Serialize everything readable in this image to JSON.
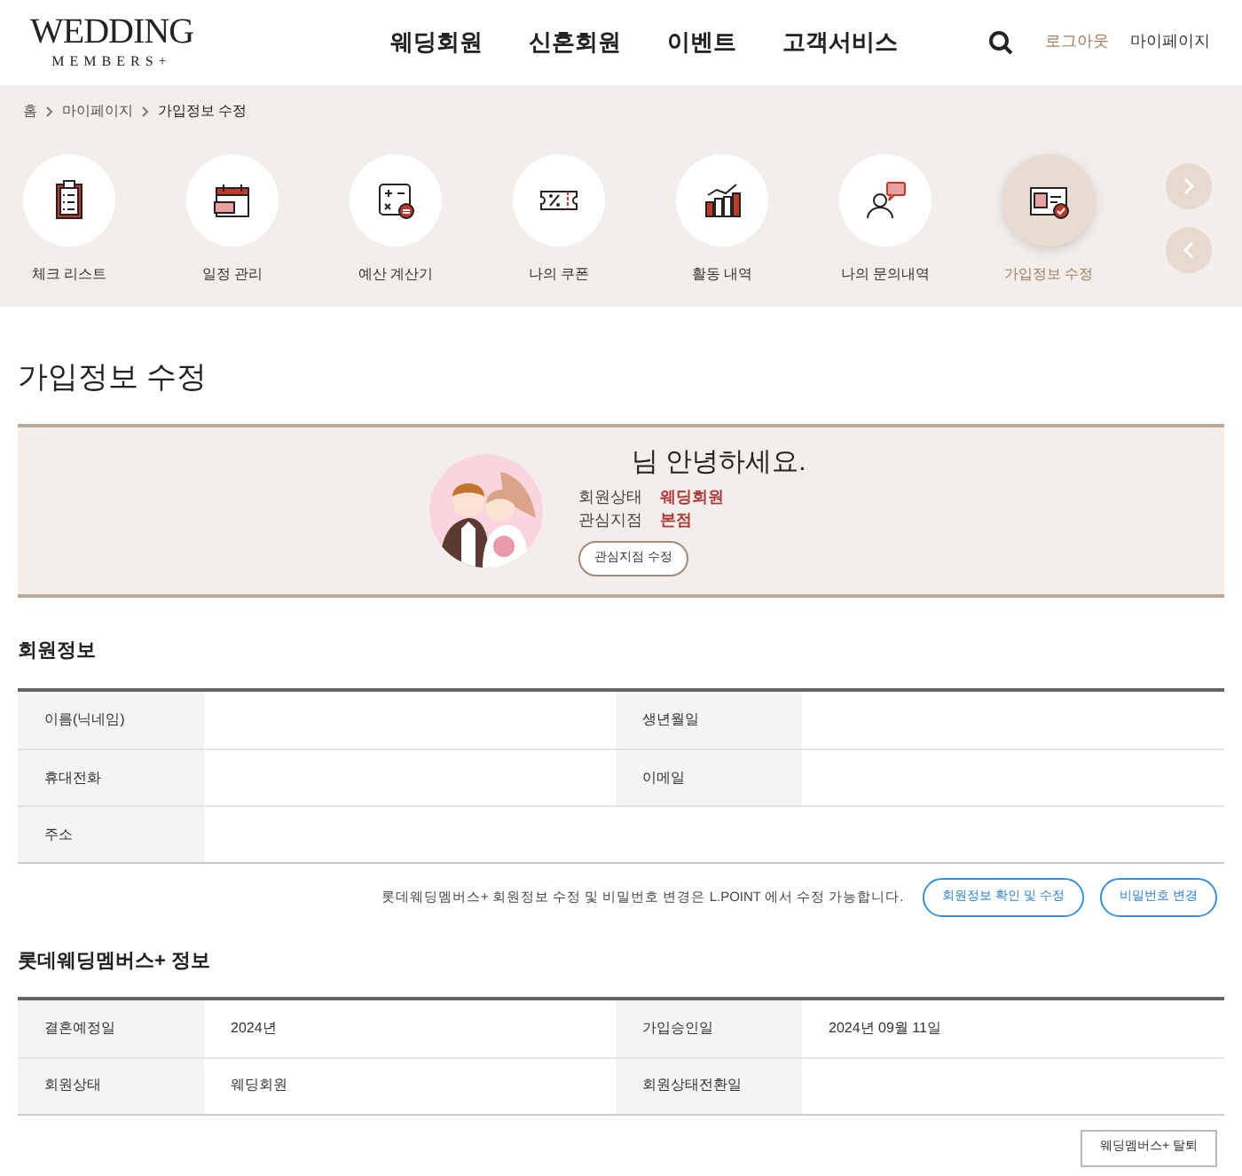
{
  "header": {
    "logo_line1": "WEDDING",
    "logo_line2": "MEMBERS+",
    "nav": [
      "웨딩회원",
      "신혼회원",
      "이벤트",
      "고객서비스"
    ],
    "logout": "로그아웃",
    "mypage": "마이페이지"
  },
  "breadcrumb": [
    "홈",
    "마이페이지",
    "가입정보 수정"
  ],
  "menu": [
    {
      "label": "체크 리스트",
      "selected": false
    },
    {
      "label": "일정 관리",
      "selected": false
    },
    {
      "label": "예산 계산기",
      "selected": false
    },
    {
      "label": "나의 쿠폰",
      "selected": false
    },
    {
      "label": "활동 내역",
      "selected": false
    },
    {
      "label": "나의 문의내역",
      "selected": false
    },
    {
      "label": "가입정보 수정",
      "selected": true
    }
  ],
  "page_title": "가입정보 수정",
  "profile": {
    "greeting": "님 안녕하세요.",
    "fields": [
      {
        "label": "회원상태",
        "value": "웨딩회원"
      },
      {
        "label": "관심지점",
        "value": "본점"
      }
    ],
    "button": "관심지점 수정"
  },
  "member_info": {
    "title": "회원정보",
    "rows": [
      [
        {
          "label": "이름(닉네임)"
        },
        {
          "label": "생년월일"
        }
      ],
      [
        {
          "label": "휴대전화"
        },
        {
          "label": "이메일"
        }
      ],
      [
        {
          "label": "주소"
        }
      ]
    ],
    "note": "롯데웨딩멤버스+ 회원정보 수정 및 비밀번호 변경은 L.POINT 에서 수정 가능합니다.",
    "buttons": [
      "회원정보 확인 및 수정",
      "비밀번호 변경"
    ]
  },
  "wedding_info": {
    "title": "롯데웨딩멤버스+ 정보",
    "rows": [
      [
        {
          "label": "결혼예정일",
          "value": "2024년"
        },
        {
          "label": "가입승인일",
          "value": "2024년 09월 11일"
        }
      ],
      [
        {
          "label": "회원상태",
          "value": "웨딩회원"
        },
        {
          "label": "회원상태전환일"
        }
      ]
    ],
    "button": "웨딩멤버스+ 탈퇴"
  }
}
